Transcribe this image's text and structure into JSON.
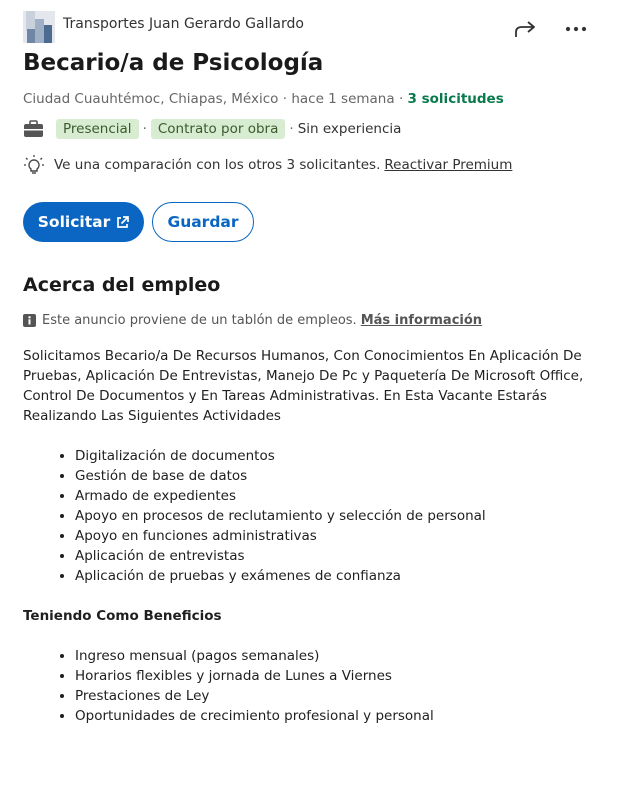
{
  "header": {
    "company_name": "Transportes Juan Gerardo Gallardo",
    "share_icon": "share-icon",
    "more_icon": "more-options-icon"
  },
  "job": {
    "title": "Becario/a de Psicología",
    "location": "Ciudad Cuauhtémoc, Chiapas, México",
    "posted": "hace 1 semana",
    "applicants": "3 solicitudes",
    "workplace_type": "Presencial",
    "contract_type": "Contrato por obra",
    "experience": "Sin experiencia"
  },
  "premium": {
    "text": "Ve una comparación con los otros 3 solicitantes.",
    "link": "Reactivar Premium"
  },
  "actions": {
    "apply_label": "Solicitar",
    "save_label": "Guardar"
  },
  "about": {
    "heading": "Acerca del empleo",
    "source_text": "Este anuncio proviene de un tablón de empleos.",
    "source_link": "Más información",
    "description": "Solicitamos Becario/a De Recursos Humanos, Con Conocimientos En Aplicación De Pruebas, Aplicación De Entrevistas, Manejo De Pc y Paquetería De Microsoft Office, Control De Documentos y En Tareas Administrativas. En Esta Vacante Estarás Realizando Las Siguientes Actividades",
    "activities": [
      "Digitalización de documentos",
      "Gestión de base de datos",
      "Armado de expedientes",
      "Apoyo en procesos de reclutamiento y selección de personal",
      "Apoyo en funciones administrativas",
      "Aplicación de entrevistas",
      "Aplicación de pruebas y exámenes de confianza"
    ],
    "benefits_heading": "Teniendo Como Beneficios",
    "benefits": [
      "Ingreso mensual (pagos semanales)",
      "Horarios flexibles y jornada de Lunes a Viernes",
      "Prestaciones de Ley",
      "Oportunidades de crecimiento profesional y personal"
    ]
  },
  "colors": {
    "primary": "#0a66c2",
    "applicants_green": "#0a7a4e",
    "tag_bg": "#d7ecd0"
  }
}
